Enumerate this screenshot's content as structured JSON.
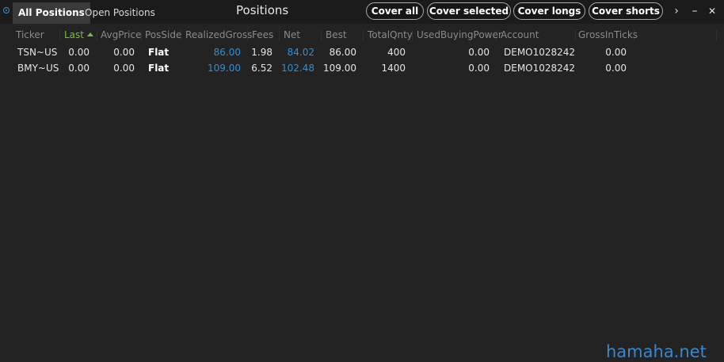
{
  "tabs": [
    "All Positions",
    "Open Positions"
  ],
  "title": "Positions",
  "buttons": {
    "cover_all": "Cover all",
    "cover_selected": "Cover selected",
    "cover_longs": "Cover longs",
    "cover_shorts": "Cover shorts"
  },
  "window_controls": {
    "more": "›",
    "minimize": "–",
    "close": "✕"
  },
  "columns": [
    "Ticker",
    "Last",
    "AvgPrice",
    "PosSide",
    "RealizedGross",
    "Fees",
    "Net",
    "Best",
    "TotalQnty",
    "UsedBuyingPower",
    "Account",
    "GrossInTicks"
  ],
  "sorted_column": "Last",
  "sort_direction": "ascending",
  "rows": [
    {
      "ticker": "TSN~US",
      "last": "0.00",
      "avg_price": "0.00",
      "pos_side": "Flat",
      "realized_gross": "86.00",
      "fees": "1.98",
      "net": "84.02",
      "best": "86.00",
      "total_qnty": "400",
      "used_buying_power": "0.00",
      "account": "DEMO1028242",
      "gross_in_ticks": "0.00"
    },
    {
      "ticker": "BMY~US",
      "last": "0.00",
      "avg_price": "0.00",
      "pos_side": "Flat",
      "realized_gross": "109.00",
      "fees": "6.52",
      "net": "102.48",
      "best": "109.00",
      "total_qnty": "1400",
      "used_buying_power": "0.00",
      "account": "DEMO1028242",
      "gross_in_ticks": "0.00"
    }
  ],
  "colors": {
    "positive_value": "#2f8fd8",
    "sorted_header": "#7cbf3a",
    "background": "#232323"
  },
  "watermark": "hamaha.net"
}
